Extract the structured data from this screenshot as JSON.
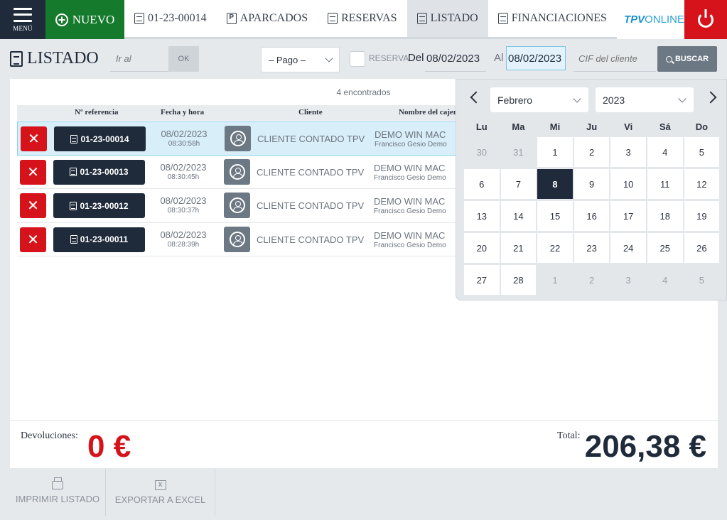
{
  "topbar": {
    "menu_label": "MENÚ",
    "nuevo_label": "NUEVO",
    "tabs": [
      {
        "label": "01-23-00014"
      },
      {
        "label": "APARCADOS"
      },
      {
        "label": "RESERVAS"
      },
      {
        "label": "LISTADO"
      },
      {
        "label": "FINANCIACIONES"
      }
    ],
    "tpv_logo_a": "TPV",
    "tpv_logo_b": "ONLINE"
  },
  "toolbar": {
    "title": "LISTADO",
    "goto_placeholder": "Ir al",
    "ok_label": "OK",
    "pago_value": "– Pago –",
    "reserva_label": "RESERVA",
    "del_label": "Del",
    "del_value": "08/02/2023",
    "al_label": "Al",
    "al_value": "08/02/2023",
    "cif_placeholder": "CIF del cliente",
    "buscar_label": "BUSCAR"
  },
  "list": {
    "found_text": "4 encontrados",
    "columns": [
      "Nº referencia",
      "Fecha y hora",
      "Cliente",
      "Nombre del cajero"
    ],
    "rows": [
      {
        "ref": "01-23-00014",
        "date": "08/02/2023",
        "time": "08:30:58h",
        "client": "CLIENTE CONTADO TPV",
        "cashier": "DEMO WIN MAC",
        "cashier_sub": "Francisco Gesio Demo"
      },
      {
        "ref": "01-23-00013",
        "date": "08/02/2023",
        "time": "08:30:45h",
        "client": "CLIENTE CONTADO TPV",
        "cashier": "DEMO WIN MAC",
        "cashier_sub": "Francisco Gesio Demo"
      },
      {
        "ref": "01-23-00012",
        "date": "08/02/2023",
        "time": "08:30:37h",
        "client": "CLIENTE CONTADO TPV",
        "cashier": "DEMO WIN MAC",
        "cashier_sub": "Francisco Gesio Demo"
      },
      {
        "ref": "01-23-00011",
        "date": "08/02/2023",
        "time": "08:28:39h",
        "client": "CLIENTE CONTADO TPV",
        "cashier": "DEMO WIN MAC",
        "cashier_sub": "Francisco Gesio Demo"
      }
    ]
  },
  "datepicker": {
    "month": "Febrero",
    "year": "2023",
    "weekdays": [
      "Lu",
      "Ma",
      "Mi",
      "Ju",
      "Vi",
      "Sá",
      "Do"
    ],
    "days": [
      {
        "d": "30",
        "other": true
      },
      {
        "d": "31",
        "other": true
      },
      {
        "d": "1"
      },
      {
        "d": "2"
      },
      {
        "d": "3"
      },
      {
        "d": "4"
      },
      {
        "d": "5"
      },
      {
        "d": "6"
      },
      {
        "d": "7"
      },
      {
        "d": "8",
        "selected": true
      },
      {
        "d": "9"
      },
      {
        "d": "10"
      },
      {
        "d": "11"
      },
      {
        "d": "12"
      },
      {
        "d": "13"
      },
      {
        "d": "14"
      },
      {
        "d": "15"
      },
      {
        "d": "16"
      },
      {
        "d": "17"
      },
      {
        "d": "18"
      },
      {
        "d": "19"
      },
      {
        "d": "20"
      },
      {
        "d": "21"
      },
      {
        "d": "22"
      },
      {
        "d": "23"
      },
      {
        "d": "24"
      },
      {
        "d": "25"
      },
      {
        "d": "26"
      },
      {
        "d": "27"
      },
      {
        "d": "28"
      },
      {
        "d": "1",
        "other": true
      },
      {
        "d": "2",
        "other": true
      },
      {
        "d": "3",
        "other": true
      },
      {
        "d": "4",
        "other": true
      },
      {
        "d": "5",
        "other": true
      }
    ]
  },
  "totals": {
    "devoluciones_label": "Devoluciones:",
    "devoluciones_value": "0 €",
    "total_label": "Total:",
    "total_value": "206,38 €"
  },
  "bottom": {
    "print_label": "IMPRIMIR LISTADO",
    "excel_label": "EXPORTAR A EXCEL"
  },
  "colors": {
    "primary_dark": "#1f2b3a",
    "nuevo_green": "#157a2b",
    "danger_red": "#d6131a",
    "selection_blue": "#d8eef8"
  }
}
